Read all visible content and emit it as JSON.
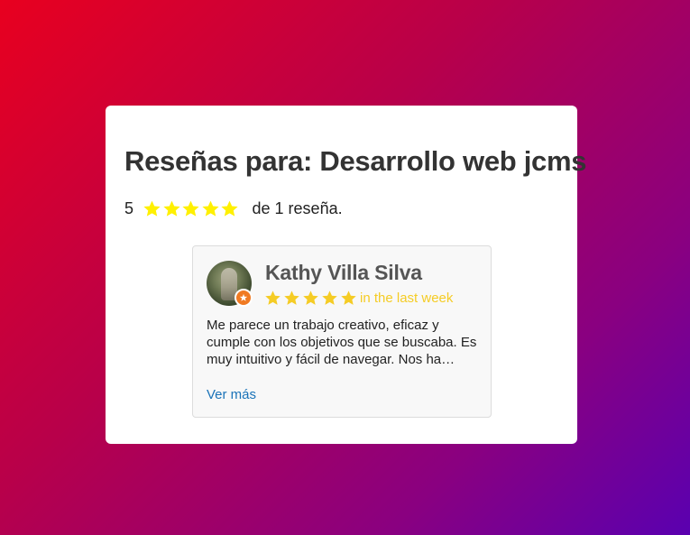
{
  "widget": {
    "title": "Reseñas para: Desarrollo web jcms",
    "summary": {
      "score": "5",
      "rating": 5,
      "count_text": "de 1 reseña."
    },
    "colors": {
      "star": "#fff000",
      "review_star": "#f5cc25",
      "badge": "#f07a22",
      "link": "#1a73b8"
    }
  },
  "reviews": [
    {
      "author": "Kathy Villa Silva",
      "rating": 5,
      "when": "in the last week",
      "text": "Me parece un trabajo creativo, eficaz y cumple con los objetivos que se buscaba. Es muy intuitivo y fácil de navegar. Nos ha…",
      "read_more": "Ver más",
      "badge_icon": "local-guide-star-icon"
    }
  ]
}
